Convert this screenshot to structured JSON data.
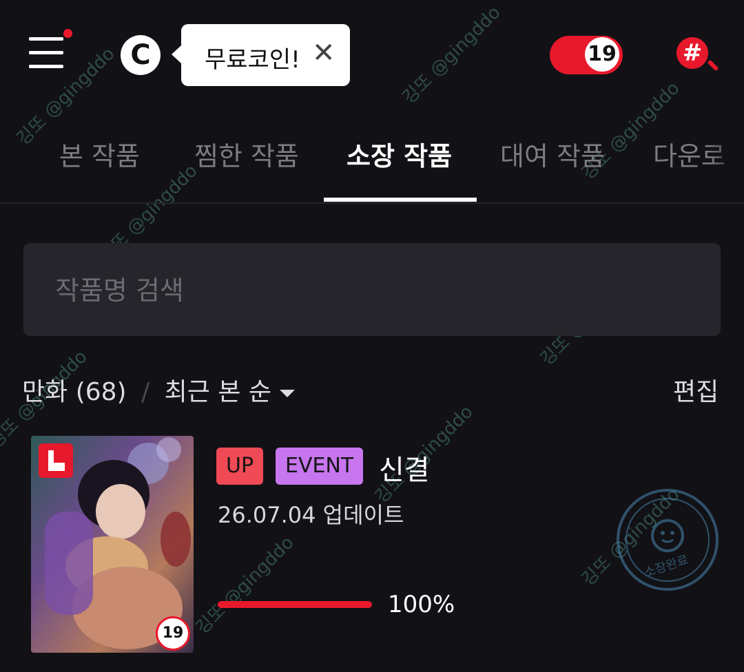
{
  "header": {
    "coin_icon_letter": "C",
    "tooltip_text": "무료코인!",
    "tooltip_close": "✕",
    "adult_toggle_label": "19",
    "search_tag_icon": "#"
  },
  "tabs": [
    {
      "label": "본 작품",
      "active": false
    },
    {
      "label": "찜한 작품",
      "active": false
    },
    {
      "label": "소장 작품",
      "active": true
    },
    {
      "label": "대여 작품",
      "active": false
    },
    {
      "label": "다운로",
      "active": false
    }
  ],
  "search": {
    "placeholder": "작품명 검색",
    "value": ""
  },
  "filter": {
    "category": "만화",
    "count": "(68)",
    "separator": "/",
    "sort": "최근 본 순",
    "edit_label": "편집"
  },
  "items": [
    {
      "tags": [
        "UP",
        "EVENT"
      ],
      "title": "신결",
      "updated": "26.07.04 업데이트",
      "progress_percent": 100,
      "progress_text": "100%",
      "age_rating": "19",
      "stamp_text": "소장완료"
    }
  ],
  "watermark_text": "깅또 @gingddo",
  "colors": {
    "background": "#121116",
    "accent_red": "#e8192c",
    "tag_up": "#ef4a55",
    "tag_event": "#c776ef",
    "search_bg": "#26252b"
  }
}
